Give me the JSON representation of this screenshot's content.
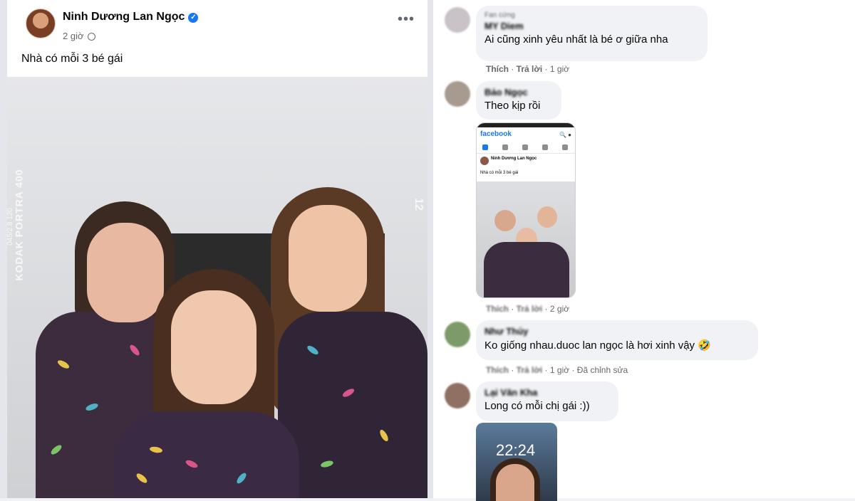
{
  "post": {
    "author": "Ninh Dương Lan Ngọc",
    "time": "2 giờ",
    "caption": "Nhà có mỗi 3 bé gái",
    "more": "•••",
    "photo_text": {
      "brand": "KODAK PORTRA 400",
      "sub": "045/2.8 120",
      "num": "12"
    }
  },
  "comments": [
    {
      "sub": "Fan cứng",
      "name": "MY Diem",
      "text": "Ai cũng xinh yêu nhất là bé ơ giữa nha",
      "like": "Thích",
      "reply": "Trả lời",
      "time": "1 giờ",
      "extra": ""
    },
    {
      "sub": "",
      "name": "Bảo Ngọc",
      "text": "Theo kịp rồi",
      "like": "Thích",
      "reply": "Trả lời",
      "time": "2 giờ",
      "extra": ""
    },
    {
      "sub": "",
      "name": "Như Thủy",
      "text": "Ko giống nhau.duoc lan ngọc là hơi xinh vậy 🤣",
      "like": "Thích",
      "reply": "Trả lời",
      "time": "1 giờ",
      "extra": "Đã chỉnh sửa"
    },
    {
      "sub": "",
      "name": "Lại Văn Kha",
      "text": "Long có mỗi chị gái :))",
      "like": "",
      "reply": "",
      "time": "",
      "extra": ""
    }
  ],
  "screenshot": {
    "logo": "facebook",
    "author": "Ninh Dương Lan Ngọc",
    "time": "1 giờ",
    "caption": "Nhà có mỗi 3 bé gái"
  },
  "phone": {
    "time": "22:24"
  }
}
